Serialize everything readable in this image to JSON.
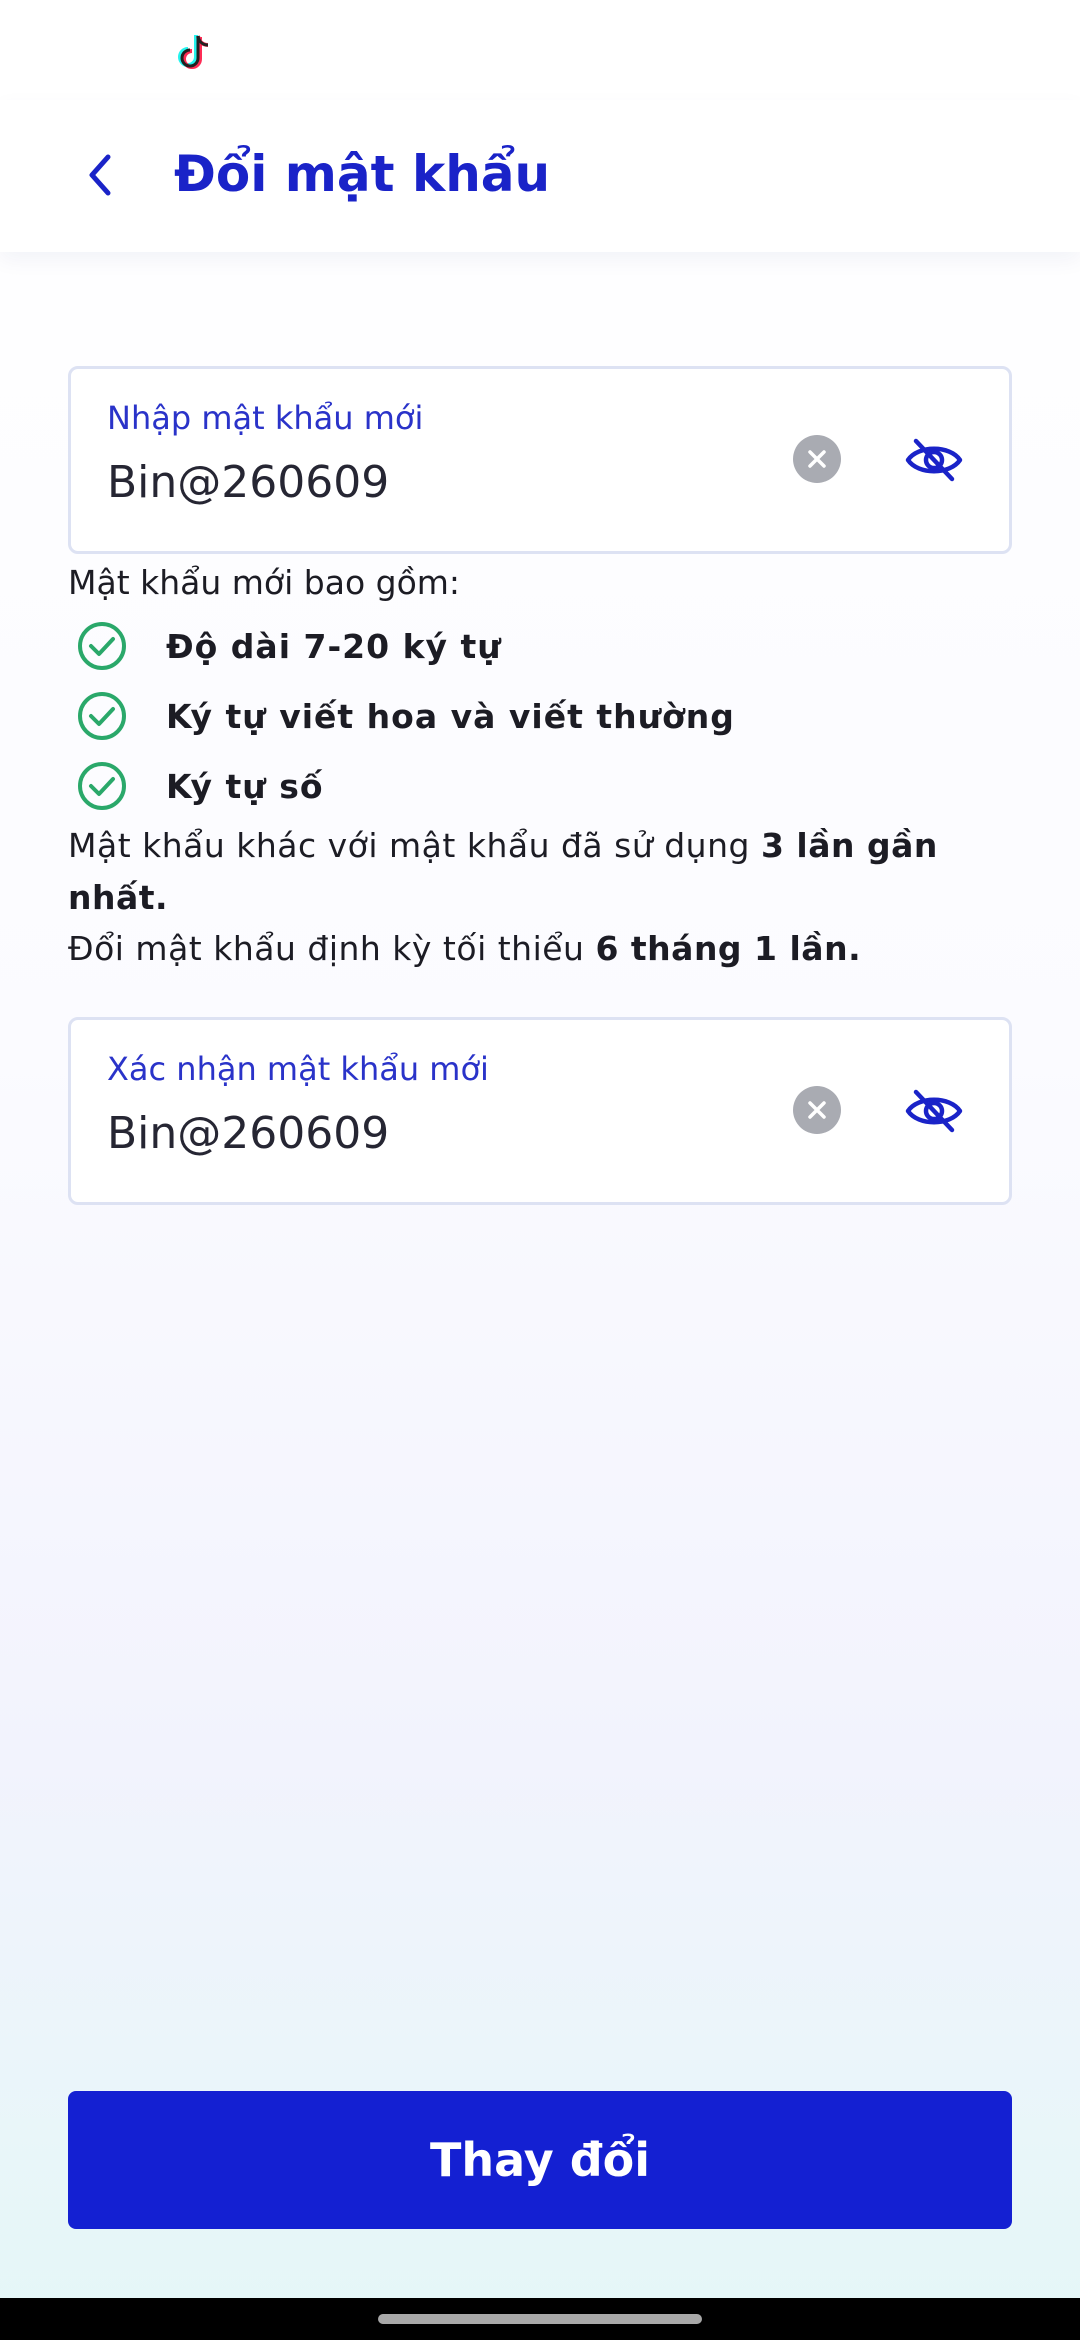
{
  "header": {
    "title": "Đổi mật khẩu"
  },
  "new_password": {
    "label": "Nhập mật khẩu mới",
    "value": "Bin@260609"
  },
  "requirements": {
    "intro": "Mật khẩu mới bao gồm:",
    "items": [
      {
        "label": "Độ dài 7-20 ký tự",
        "met": true
      },
      {
        "label": "Ký tự viết hoa và viết thường",
        "met": true
      },
      {
        "label": "Ký tự số",
        "met": true
      }
    ],
    "history_prefix": "Mật khẩu khác với mật khẩu đã sử dụng ",
    "history_bold": "3 lần gần nhất.",
    "period_prefix": "Đổi mật khẩu định kỳ tối thiểu ",
    "period_bold": "6 tháng 1 lần."
  },
  "confirm_password": {
    "label": "Xác nhận mật khẩu mới",
    "value": "Bin@260609"
  },
  "submit": {
    "label": "Thay đổi"
  },
  "colors": {
    "primary": "#1420d2",
    "accent_text": "#2a33c9",
    "check": "#2aa86a"
  },
  "icons": [
    "tiktok-icon",
    "back-arrow-icon",
    "clear-icon",
    "eye-off-icon",
    "check-circle-icon"
  ]
}
